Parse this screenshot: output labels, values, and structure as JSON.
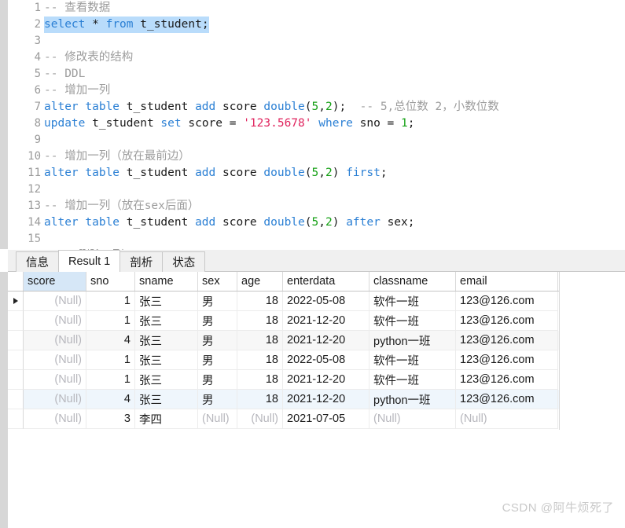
{
  "editor": {
    "lines": [
      {
        "no": "1",
        "selected": false,
        "tokens": [
          {
            "t": "-- 查看数据",
            "c": "cmt"
          }
        ]
      },
      {
        "no": "2",
        "selected": true,
        "tokens": [
          {
            "t": "select",
            "c": "kw"
          },
          {
            "t": " * ",
            "c": "plain"
          },
          {
            "t": "from",
            "c": "kw"
          },
          {
            "t": " t_student;",
            "c": "plain"
          }
        ]
      },
      {
        "no": "3",
        "selected": false,
        "tokens": [
          {
            "t": "",
            "c": "plain"
          }
        ]
      },
      {
        "no": "4",
        "selected": false,
        "tokens": [
          {
            "t": "-- 修改表的结构",
            "c": "cmt"
          }
        ]
      },
      {
        "no": "5",
        "selected": false,
        "tokens": [
          {
            "t": "-- DDL",
            "c": "cmt"
          }
        ]
      },
      {
        "no": "6",
        "selected": false,
        "tokens": [
          {
            "t": "-- 增加一列",
            "c": "cmt"
          }
        ]
      },
      {
        "no": "7",
        "selected": false,
        "tokens": [
          {
            "t": "alter",
            "c": "kw"
          },
          {
            "t": " ",
            "c": "plain"
          },
          {
            "t": "table",
            "c": "kw"
          },
          {
            "t": " t_student ",
            "c": "plain"
          },
          {
            "t": "add",
            "c": "kw"
          },
          {
            "t": " score ",
            "c": "plain"
          },
          {
            "t": "double",
            "c": "kw"
          },
          {
            "t": "(",
            "c": "punct"
          },
          {
            "t": "5",
            "c": "num"
          },
          {
            "t": ",",
            "c": "punct"
          },
          {
            "t": "2",
            "c": "num"
          },
          {
            "t": ");  ",
            "c": "punct"
          },
          {
            "t": "-- 5,总位数 2，小数位数",
            "c": "cmt"
          }
        ]
      },
      {
        "no": "8",
        "selected": false,
        "tokens": [
          {
            "t": "update",
            "c": "kw"
          },
          {
            "t": " t_student ",
            "c": "plain"
          },
          {
            "t": "set",
            "c": "kw"
          },
          {
            "t": " score = ",
            "c": "plain"
          },
          {
            "t": "'123.5678'",
            "c": "str"
          },
          {
            "t": " ",
            "c": "plain"
          },
          {
            "t": "where",
            "c": "kw"
          },
          {
            "t": " sno = ",
            "c": "plain"
          },
          {
            "t": "1",
            "c": "num"
          },
          {
            "t": ";",
            "c": "punct"
          }
        ]
      },
      {
        "no": "9",
        "selected": false,
        "tokens": [
          {
            "t": "",
            "c": "plain"
          }
        ]
      },
      {
        "no": "10",
        "selected": false,
        "tokens": [
          {
            "t": "-- 增加一列（放在最前边）",
            "c": "cmt"
          }
        ]
      },
      {
        "no": "11",
        "selected": false,
        "tokens": [
          {
            "t": "alter",
            "c": "kw"
          },
          {
            "t": " ",
            "c": "plain"
          },
          {
            "t": "table",
            "c": "kw"
          },
          {
            "t": " t_student ",
            "c": "plain"
          },
          {
            "t": "add",
            "c": "kw"
          },
          {
            "t": " score ",
            "c": "plain"
          },
          {
            "t": "double",
            "c": "kw"
          },
          {
            "t": "(",
            "c": "punct"
          },
          {
            "t": "5",
            "c": "num"
          },
          {
            "t": ",",
            "c": "punct"
          },
          {
            "t": "2",
            "c": "num"
          },
          {
            "t": ") ",
            "c": "punct"
          },
          {
            "t": "first",
            "c": "kw"
          },
          {
            "t": ";",
            "c": "punct"
          }
        ]
      },
      {
        "no": "12",
        "selected": false,
        "tokens": [
          {
            "t": "",
            "c": "plain"
          }
        ]
      },
      {
        "no": "13",
        "selected": false,
        "tokens": [
          {
            "t": "-- 增加一列（放在sex后面）",
            "c": "cmt"
          }
        ]
      },
      {
        "no": "14",
        "selected": false,
        "tokens": [
          {
            "t": "alter",
            "c": "kw"
          },
          {
            "t": " ",
            "c": "plain"
          },
          {
            "t": "table",
            "c": "kw"
          },
          {
            "t": " t_student ",
            "c": "plain"
          },
          {
            "t": "add",
            "c": "kw"
          },
          {
            "t": " score ",
            "c": "plain"
          },
          {
            "t": "double",
            "c": "kw"
          },
          {
            "t": "(",
            "c": "punct"
          },
          {
            "t": "5",
            "c": "num"
          },
          {
            "t": ",",
            "c": "punct"
          },
          {
            "t": "2",
            "c": "num"
          },
          {
            "t": ") ",
            "c": "punct"
          },
          {
            "t": "after",
            "c": "kw"
          },
          {
            "t": " sex;",
            "c": "plain"
          }
        ]
      },
      {
        "no": "15",
        "selected": false,
        "tokens": [
          {
            "t": "",
            "c": "plain"
          }
        ]
      },
      {
        "no": "16",
        "selected": false,
        "tokens": [
          {
            "t": "  -- 删除一列",
            "c": "cmt"
          }
        ]
      }
    ]
  },
  "tabs": [
    {
      "label": "信息",
      "active": false
    },
    {
      "label": "Result 1",
      "active": true
    },
    {
      "label": "剖析",
      "active": false
    },
    {
      "label": "状态",
      "active": false
    }
  ],
  "grid": {
    "columns": [
      {
        "key": "score",
        "label": "score",
        "align": "right",
        "selected": true,
        "cls": "c-score"
      },
      {
        "key": "sno",
        "label": "sno",
        "align": "right",
        "selected": false,
        "cls": "c-sno"
      },
      {
        "key": "sname",
        "label": "sname",
        "align": "left",
        "selected": false,
        "cls": "c-sname"
      },
      {
        "key": "sex",
        "label": "sex",
        "align": "left",
        "selected": false,
        "cls": "c-sex"
      },
      {
        "key": "age",
        "label": "age",
        "align": "right",
        "selected": false,
        "cls": "c-age"
      },
      {
        "key": "enterdata",
        "label": "enterdata",
        "align": "left",
        "selected": false,
        "cls": "c-enterdata"
      },
      {
        "key": "classname",
        "label": "classname",
        "align": "left",
        "selected": false,
        "cls": "c-classname"
      },
      {
        "key": "email",
        "label": "email",
        "align": "left",
        "selected": false,
        "cls": "c-email"
      }
    ],
    "null_text": "(Null)",
    "rows": [
      {
        "current": true,
        "stripe": "none",
        "cells": {
          "score": null,
          "sno": "1",
          "sname": "张三",
          "sex": "男",
          "age": "18",
          "enterdata": "2022-05-08",
          "classname": "软件一班",
          "email": "123@126.com"
        }
      },
      {
        "current": false,
        "stripe": "none",
        "cells": {
          "score": null,
          "sno": "1",
          "sname": "张三",
          "sex": "男",
          "age": "18",
          "enterdata": "2021-12-20",
          "classname": "软件一班",
          "email": "123@126.com"
        }
      },
      {
        "current": false,
        "stripe": "alt",
        "cells": {
          "score": null,
          "sno": "4",
          "sname": "张三",
          "sex": "男",
          "age": "18",
          "enterdata": "2021-12-20",
          "classname": "python一班",
          "email": "123@126.com"
        }
      },
      {
        "current": false,
        "stripe": "none",
        "cells": {
          "score": null,
          "sno": "1",
          "sname": "张三",
          "sex": "男",
          "age": "18",
          "enterdata": "2022-05-08",
          "classname": "软件一班",
          "email": "123@126.com"
        }
      },
      {
        "current": false,
        "stripe": "none",
        "cells": {
          "score": null,
          "sno": "1",
          "sname": "张三",
          "sex": "男",
          "age": "18",
          "enterdata": "2021-12-20",
          "classname": "软件一班",
          "email": "123@126.com"
        }
      },
      {
        "current": false,
        "stripe": "blue",
        "cells": {
          "score": null,
          "sno": "4",
          "sname": "张三",
          "sex": "男",
          "age": "18",
          "enterdata": "2021-12-20",
          "classname": "python一班",
          "email": "123@126.com"
        }
      },
      {
        "current": false,
        "stripe": "none",
        "cells": {
          "score": null,
          "sno": "3",
          "sname": "李四",
          "sex": null,
          "age": null,
          "enterdata": "2021-07-05",
          "classname": null,
          "email": null
        }
      }
    ]
  },
  "watermark": {
    "text": "CSDN @阿牛烦死了"
  },
  "colors": {
    "keyword": "#2a7fd4",
    "comment": "#9d9d9d",
    "number": "#15a015",
    "string": "#e0245e",
    "selection": "#b9dcfb",
    "header_selected": "#d6e7f7",
    "row_blue": "#eff6fc",
    "row_alt": "#f7f7f7"
  }
}
